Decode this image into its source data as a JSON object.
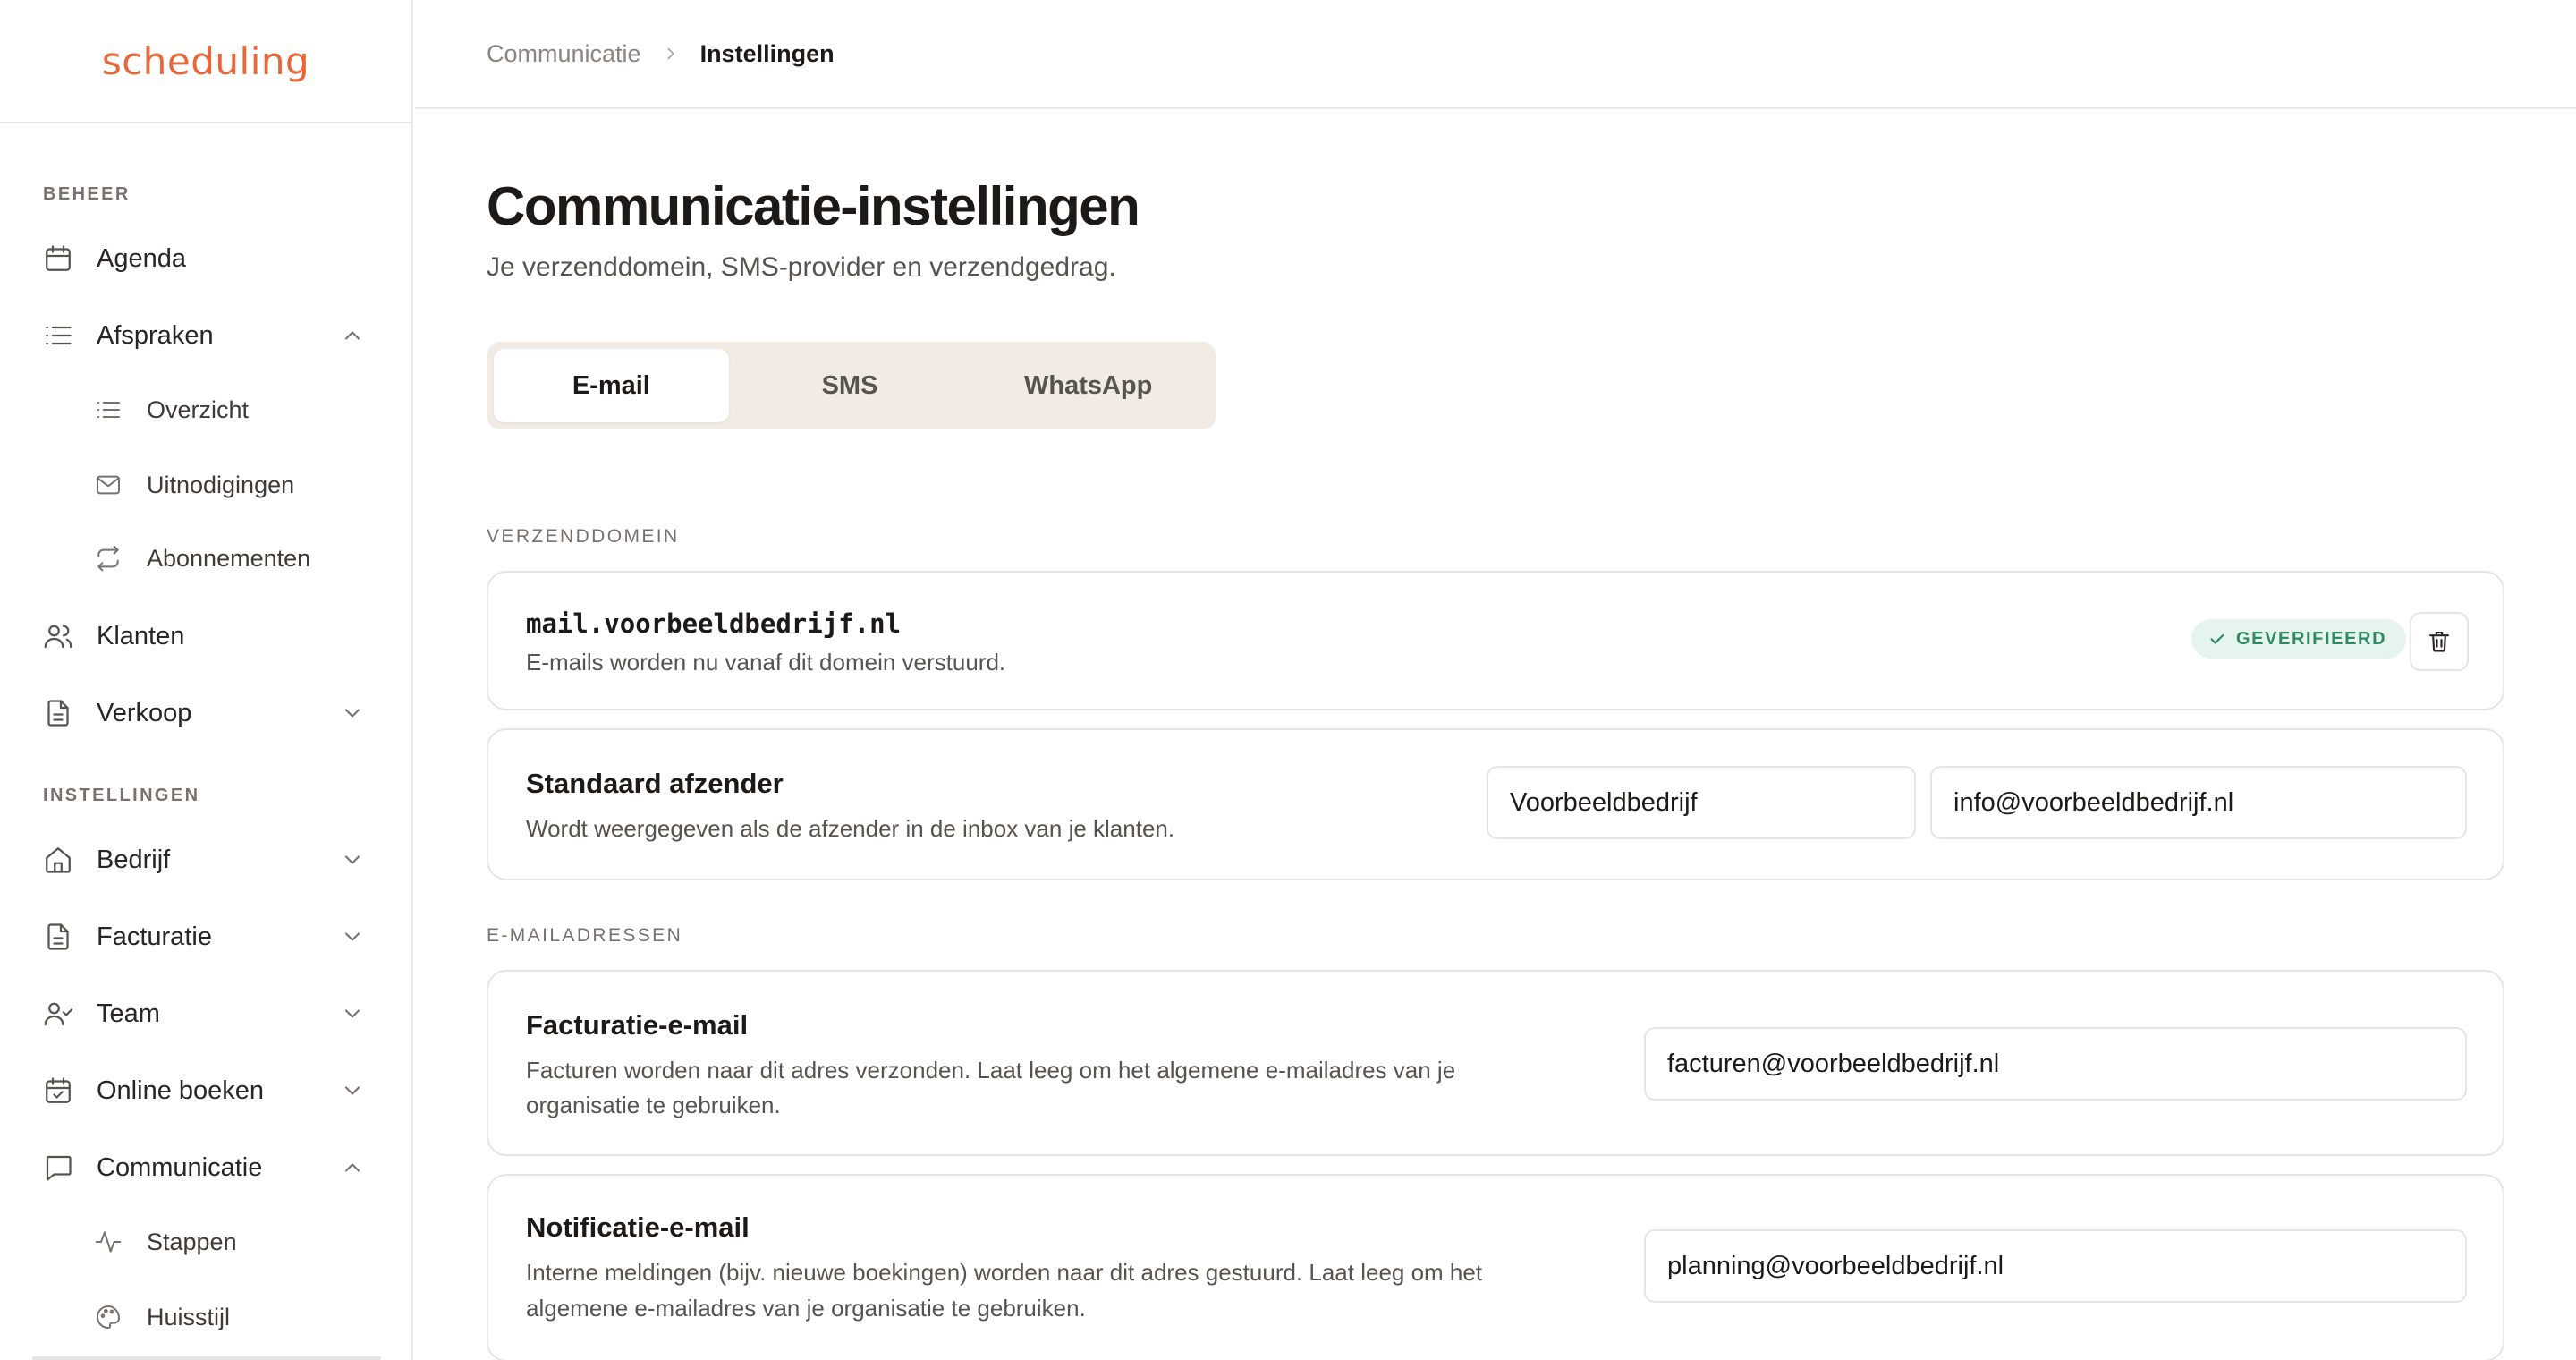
{
  "brand": {
    "logo_text": "scheduling",
    "accent": "#e8663a"
  },
  "sidebar": {
    "sections": [
      {
        "label": "BEHEER"
      },
      {
        "label": "INSTELLINGEN"
      }
    ],
    "items": {
      "agenda": {
        "label": "Agenda",
        "icon": "calendar-icon"
      },
      "afspraken": {
        "label": "Afspraken",
        "icon": "list-icon",
        "expanded": true
      },
      "overzicht": {
        "label": "Overzicht",
        "icon": "list-icon"
      },
      "uitnodigingen": {
        "label": "Uitnodigingen",
        "icon": "mail-icon"
      },
      "abonnementen": {
        "label": "Abonnementen",
        "icon": "repeat-icon"
      },
      "klanten": {
        "label": "Klanten",
        "icon": "users-icon"
      },
      "verkoop": {
        "label": "Verkoop",
        "icon": "document-icon",
        "expanded": false
      },
      "bedrijf": {
        "label": "Bedrijf",
        "icon": "home-icon",
        "expanded": false
      },
      "facturatie": {
        "label": "Facturatie",
        "icon": "document-icon",
        "expanded": false
      },
      "team": {
        "label": "Team",
        "icon": "user-check-icon",
        "expanded": false
      },
      "online_boeken": {
        "label": "Online boeken",
        "icon": "calendar-check-icon",
        "expanded": false
      },
      "communicatie": {
        "label": "Communicatie",
        "icon": "message-icon",
        "expanded": true
      },
      "stappen": {
        "label": "Stappen",
        "icon": "activity-icon"
      },
      "huisstijl": {
        "label": "Huisstijl",
        "icon": "palette-icon"
      }
    }
  },
  "breadcrumb": {
    "parent": "Communicatie",
    "current": "Instellingen"
  },
  "page": {
    "title": "Communicatie-instellingen",
    "subtitle": "Je verzenddomein, SMS-provider en verzendgedrag."
  },
  "tabs": [
    {
      "label": "E-mail",
      "active": true
    },
    {
      "label": "SMS",
      "active": false
    },
    {
      "label": "WhatsApp",
      "active": false
    }
  ],
  "domain_section": {
    "label": "VERZENDDOMEIN",
    "domain": "mail.voorbeeldbedrijf.nl",
    "description": "E-mails worden nu vanaf dit domein verstuurd.",
    "status": "GEVERIFIEERD",
    "status_color": "#2f8a63"
  },
  "sender": {
    "title": "Standaard afzender",
    "description": "Wordt weergegeven als de afzender in de inbox van je klanten.",
    "name_value": "Voorbeeldbedrijf",
    "email_value": "info@voorbeeldbedrijf.nl"
  },
  "addresses_section": {
    "label": "E-MAILADRESSEN",
    "billing": {
      "title": "Facturatie-e-mail",
      "description_line1": "Facturen worden naar dit adres verzonden. Laat leeg om het algemene e-mailadres van je",
      "description_line2": "organisatie te gebruiken.",
      "value": "facturen@voorbeeldbedrijf.nl"
    },
    "notification": {
      "title": "Notificatie-e-mail",
      "description_line1": "Interne meldingen (bijv. nieuwe boekingen) worden naar dit adres gestuurd. Laat leeg om het",
      "description_line2": "algemene e-mailadres van je organisatie te gebruiken.",
      "value": "planning@voorbeeldbedrijf.nl"
    }
  }
}
